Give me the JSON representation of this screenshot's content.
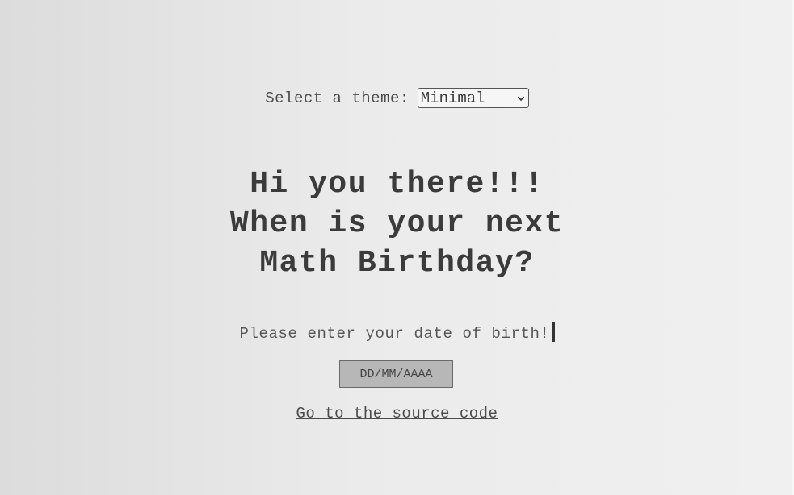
{
  "theme": {
    "label": "Select a theme:",
    "selected": "Minimal"
  },
  "heading": {
    "line1": "Hi you there!!!",
    "line2": "When is your next",
    "line3": "Math Birthday?"
  },
  "prompt": {
    "text": "Please enter your date of birth!"
  },
  "date_input": {
    "placeholder": "DD/MM/AAAA",
    "value": ""
  },
  "link": {
    "label": "Go to the source code"
  }
}
